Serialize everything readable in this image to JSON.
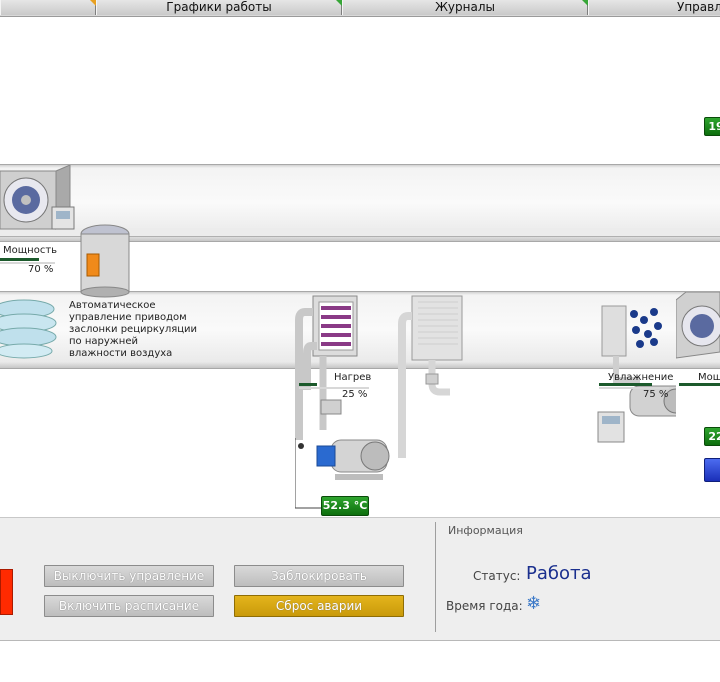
{
  "tabs": [
    {
      "label": "Графики работы"
    },
    {
      "label": "Журналы"
    },
    {
      "label": "Управл"
    }
  ],
  "colors": {
    "value_green": "#1b8a1b",
    "alarm_yellow": "#d8a814",
    "stop_red": "#ff2a00",
    "status_blue": "#1a2f8e"
  },
  "values": {
    "top_right": "19",
    "right_mid": "22",
    "water_temp": "52.3 °C"
  },
  "fan": {
    "label": "Мощность",
    "percent_text": "70 %",
    "level": 0.7
  },
  "recirc": {
    "text": [
      "Автоматическое",
      "управление приводом",
      "заслонки рециркуляции",
      "по наружней",
      "влажности воздуха"
    ]
  },
  "heater": {
    "label": "Нагрев",
    "percent_text": "25 %",
    "level": 0.25
  },
  "humid": {
    "label": "Увлажнение",
    "percent_text": "75 %",
    "level": 0.75
  },
  "fan2": {
    "label": "Мощн"
  },
  "buttons": {
    "disable_control": "Выключить управление",
    "block": "Заблокировать",
    "enable_schedule": "Включить расписание",
    "reset_alarm": "Сброс аварии"
  },
  "info": {
    "title": "Информация",
    "status_label": "Статус:",
    "status_value": "Работа",
    "season_label": "Время года:",
    "season_icon": "snowflake-icon",
    "season_glyph": "❄"
  }
}
